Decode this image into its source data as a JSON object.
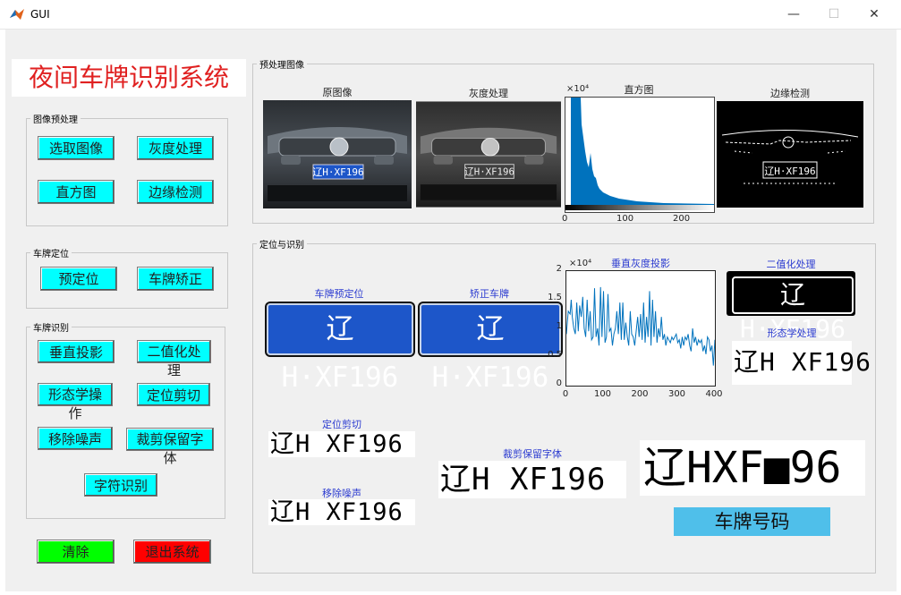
{
  "window": {
    "title": "GUI",
    "min": "—",
    "max": "☐",
    "close": "✕"
  },
  "app_title": "夜间车牌识别系统",
  "preprocess_panel": {
    "legend": "图像预处理",
    "buttons": {
      "select": "选取图像",
      "gray": "灰度处理",
      "hist": "直方图",
      "edge": "边缘检测"
    }
  },
  "locate_panel": {
    "legend": "车牌定位",
    "buttons": {
      "prelocate": "预定位",
      "correct": "车牌矫正"
    }
  },
  "recog_panel": {
    "legend": "车牌识别",
    "buttons": {
      "vproj": "垂直投影",
      "binar": "二值化处理",
      "morph": "形态学操作",
      "crop": "定位剪切",
      "denoise": "移除噪声",
      "cropkeep": "裁剪保留字体",
      "charrec": "字符识别"
    }
  },
  "bottom_buttons": {
    "clear": "清除",
    "exit": "退出系统"
  },
  "colors": {
    "cyan": "#00ffff",
    "green": "#00ff00",
    "red": "#ff0000",
    "title_red": "#e02020",
    "result_blue": "#4fbfea",
    "hist_blue": "#0072bd"
  },
  "preview_panel": {
    "legend": "预处理图像",
    "labels": {
      "original": "原图像",
      "gray": "灰度处理",
      "hist": "直方图",
      "edge": "边缘检测"
    },
    "hist_exponent": "×10⁴",
    "hist_ticks_x": [
      "0",
      "100",
      "200"
    ]
  },
  "locate_recog_panel": {
    "legend": "定位与识别",
    "labels": {
      "prelocate": "车牌预定位",
      "corrected": "矫正车牌",
      "vproj": "垂直灰度投影",
      "binar": "二值化处理",
      "morph": "形态学处理",
      "crop": "定位剪切",
      "denoise": "移除噪声",
      "cropkeep": "裁剪保留字体"
    },
    "plate_text": "辽H·XF196",
    "bin_text": "辽H·XF196",
    "morph_text": "辽H XF196",
    "crop_text": "辽H XF196",
    "denoise_text": "辽H XF196",
    "cropkeep_text": "辽H XF196",
    "chars_text": "辽HXF■96",
    "result_label": "车牌号码"
  },
  "car_plate_small": "辽H·XF196",
  "chart_data": {
    "type": "line",
    "title": "垂直灰度投影",
    "xlabel": "",
    "ylabel": "",
    "exponent_label": "×10⁴",
    "xlim": [
      0,
      400
    ],
    "ylim": [
      0,
      2
    ],
    "xticks": [
      "0",
      "100",
      "200",
      "300",
      "400"
    ],
    "yticks": [
      "0",
      "0.5",
      "1",
      "1.5",
      "2"
    ],
    "x": [
      0,
      5,
      10,
      13,
      16,
      20,
      24,
      28,
      32,
      36,
      40,
      44,
      48,
      52,
      56,
      60,
      64,
      68,
      72,
      76,
      80,
      84,
      88,
      92,
      96,
      100,
      104,
      108,
      112,
      116,
      120,
      124,
      128,
      132,
      136,
      140,
      144,
      148,
      152,
      156,
      160,
      164,
      168,
      172,
      176,
      180,
      184,
      188,
      192,
      196,
      200,
      204,
      208,
      212,
      216,
      220,
      224,
      228,
      232,
      236,
      240,
      244,
      248,
      252,
      256,
      260,
      264,
      268,
      272,
      276,
      280,
      284,
      288,
      292,
      296,
      300,
      304,
      308,
      312,
      316,
      320,
      324,
      328,
      332,
      336,
      340,
      344,
      348,
      352,
      356,
      360,
      364,
      368,
      372,
      376,
      380,
      384,
      388,
      392,
      396,
      400
    ],
    "y": [
      0.9,
      1.3,
      1.25,
      1.5,
      1.2,
      1.0,
      0.9,
      1.45,
      0.95,
      1.4,
      1.2,
      1.55,
      1.0,
      0.85,
      1.5,
      0.95,
      1.3,
      0.8,
      0.85,
      1.7,
      0.85,
      1.0,
      0.7,
      1.72,
      0.85,
      1.65,
      0.75,
      0.85,
      1.6,
      0.95,
      1.0,
      0.7,
      0.9,
      1.0,
      1.3,
      0.9,
      1.45,
      0.8,
      1.45,
      0.8,
      1.1,
      0.85,
      0.7,
      1.3,
      0.9,
      0.85,
      0.7,
      0.95,
      1.2,
      0.85,
      1.25,
      0.8,
      1.45,
      0.75,
      1.2,
      0.85,
      1.65,
      0.7,
      1.5,
      0.85,
      1.3,
      0.75,
      1.0,
      0.85,
      1.2,
      0.8,
      0.9,
      0.7,
      0.85,
      0.8,
      0.75,
      0.85,
      0.8,
      0.85,
      0.9,
      0.75,
      0.8,
      0.65,
      0.85,
      0.7,
      0.85,
      0.8,
      0.9,
      0.7,
      0.6,
      1.0,
      0.75,
      0.85,
      0.7,
      0.8,
      0.75,
      0.8,
      0.6,
      0.7,
      0.55,
      0.85,
      0.8,
      0.6,
      0.7,
      0.35,
      0.8
    ]
  }
}
